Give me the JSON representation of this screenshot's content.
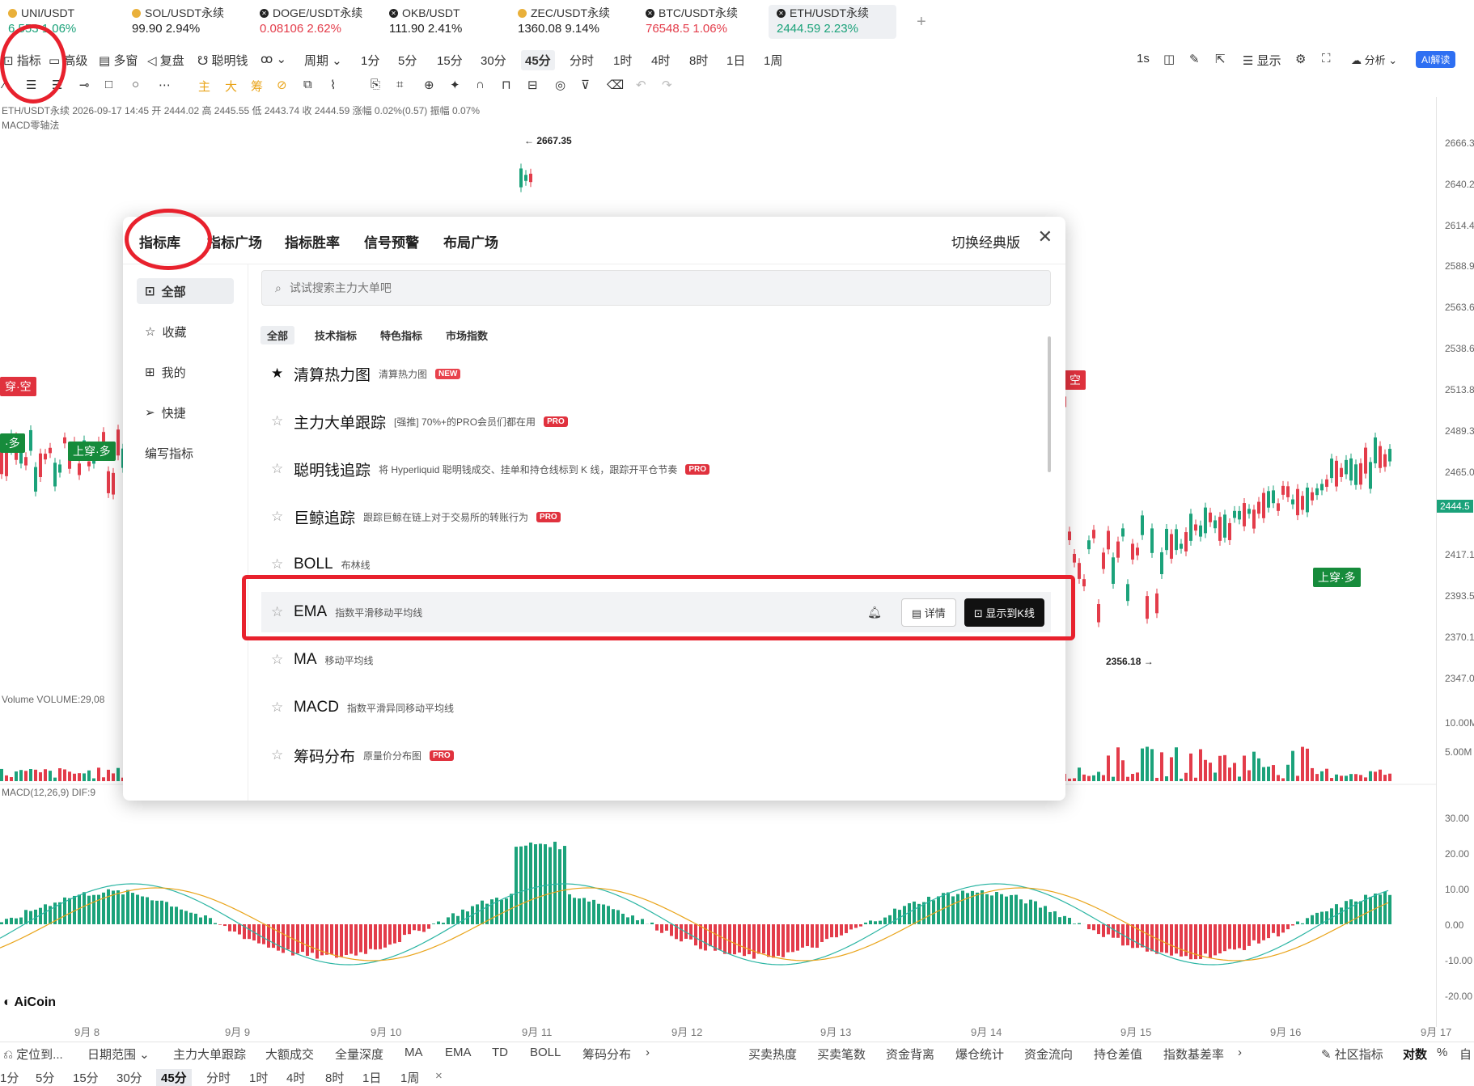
{
  "tickers": [
    {
      "name": "UNI/USDT",
      "value": "6.553",
      "change": "1.06%",
      "dir": "green",
      "icon": "uni-coin-icon"
    },
    {
      "name": "SOL/USDT永续",
      "value": "99.90",
      "change": "2.94%",
      "dir": "green",
      "icon": "sol-coin-icon"
    },
    {
      "name": "DOGE/USDT永续",
      "value": "0.08106",
      "change": "2.62%",
      "dir": "red",
      "icon": "doge-coin-icon"
    },
    {
      "name": "OKB/USDT",
      "value": "111.90",
      "change": "2.41%",
      "dir": "green",
      "icon": "okb-coin-icon"
    },
    {
      "name": "ZEC/USDT永续",
      "value": "1360.08",
      "change": "9.14%",
      "dir": "green",
      "icon": "zec-coin-icon"
    },
    {
      "name": "BTC/USDT永续",
      "value": "76548.5",
      "change": "1.06%",
      "dir": "red",
      "icon": "btc-coin-icon"
    },
    {
      "name": "ETH/USDT永续",
      "value": "2444.59",
      "change": "2.23%",
      "dir": "green",
      "icon": "eth-coin-icon"
    }
  ],
  "toolbar": {
    "indicator": "指标",
    "advanced": "高级",
    "multi": "多窗",
    "replay": "复盘",
    "smart": "聪明钱",
    "period": "周期",
    "periods": [
      "1分",
      "5分",
      "15分",
      "30分",
      "45分",
      "分时",
      "1时",
      "4时",
      "8时",
      "1日",
      "1周"
    ],
    "selected_period": "45分",
    "right_1s": "1s",
    "display": "显示",
    "analysis": "分析",
    "ai": "AI解读"
  },
  "drawtools": [
    "主",
    "大",
    "筹"
  ],
  "chart_info": {
    "line1": "ETH/USDT永续 2026-09-17 14:45 开 2444.02 高 2445.55 低 2443.74 收 2444.59 涨幅 0.02%(0.57) 振幅 0.07%",
    "line2": "MACD零轴法",
    "volume": "Volume VOLUME:29,08",
    "macd": "MACD(12,26,9) DIF:9",
    "high_mark": "← 2667.35",
    "low_mark": "2356.18 →"
  },
  "price_axis": [
    "2666.3",
    "2640.2",
    "2614.4",
    "2588.9",
    "2563.6",
    "2538.6",
    "2513.8",
    "2489.3",
    "2465.0",
    "2417.1",
    "2393.5",
    "2370.1",
    "2347.0",
    "10.00M",
    "5.00M",
    "30.00",
    "20.00",
    "10.00",
    "0.00",
    "-10.00",
    "-20.00"
  ],
  "current_price": "2444.5",
  "signals": {
    "short": "穿·空",
    "long_a": "·多",
    "long_b": "上穿·多",
    "long_c": "上穿·多",
    "short_b": "空"
  },
  "dates": [
    "9月 8",
    "9月 9",
    "9月 10",
    "9月 11",
    "9月 12",
    "9月 13",
    "9月 14",
    "9月 15",
    "9月 16",
    "9月 17"
  ],
  "logo": "AiCoin",
  "bottom_bar": {
    "locate": "定位到...",
    "date_range": "日期范围",
    "items": [
      "主力大单跟踪",
      "大额成交",
      "全量深度",
      "MA",
      "EMA",
      "TD",
      "BOLL",
      "筹码分布"
    ],
    "right_items": [
      "买卖热度",
      "买卖笔数",
      "资金背离",
      "爆仓统计",
      "资金流向",
      "持仓差值",
      "指数基差率"
    ],
    "community": "社区指标",
    "log": "对数",
    "percent": "%",
    "auto": "自"
  },
  "bottom_periods": [
    "1分",
    "5分",
    "15分",
    "30分",
    "45分",
    "分时",
    "1时",
    "4时",
    "8时",
    "1日",
    "1周"
  ],
  "modal": {
    "tabs": [
      "指标库",
      "指标广场",
      "指标胜率",
      "信号预警",
      "布局广场"
    ],
    "classic": "切换经典版",
    "sidebar": [
      "全部",
      "收藏",
      "我的",
      "快捷",
      "编写指标"
    ],
    "search_placeholder": "试试搜索主力大单吧",
    "categories": [
      "全部",
      "技术指标",
      "特色指标",
      "市场指数"
    ],
    "rows": [
      {
        "name": "清算热力图",
        "desc": "清算热力图",
        "badge": "NEW",
        "starred": true
      },
      {
        "name": "主力大单跟踪",
        "desc": "[强推] 70%+的PRO会员们都在用",
        "badge": "PRO",
        "starred": false
      },
      {
        "name": "聪明钱追踪",
        "desc": "将 Hyperliquid 聪明钱成交、挂单和持仓线标到 K 线，跟踪开平仓节奏",
        "badge": "PRO",
        "starred": false
      },
      {
        "name": "巨鲸追踪",
        "desc": "跟踪巨鲸在链上对于交易所的转账行为",
        "badge": "PRO",
        "starred": false
      },
      {
        "name": "BOLL",
        "desc": "布林线",
        "badge": "",
        "starred": false
      },
      {
        "name": "EMA",
        "desc": "指数平滑移动平均线",
        "badge": "",
        "starred": false
      },
      {
        "name": "MA",
        "desc": "移动平均线",
        "badge": "",
        "starred": false
      },
      {
        "name": "MACD",
        "desc": "指数平滑异同移动平均线",
        "badge": "",
        "starred": false
      },
      {
        "name": "筹码分布",
        "desc": "原量价分布图",
        "badge": "PRO",
        "starred": false
      }
    ],
    "detail_btn": "详情",
    "show_btn": "显示到K线"
  },
  "colors": {
    "up": "#1ba27a",
    "down": "#e33c4a",
    "annotation": "#e8212d"
  }
}
